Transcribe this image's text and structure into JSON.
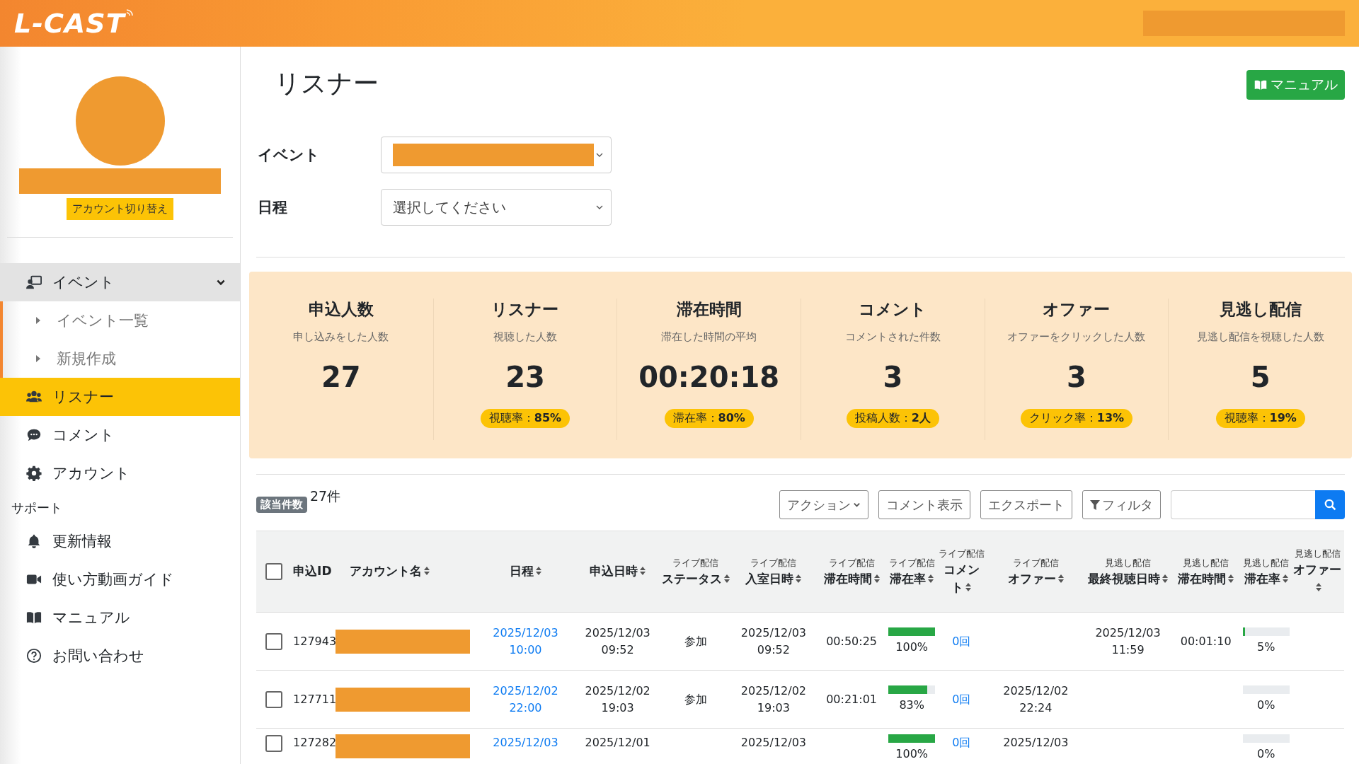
{
  "header": {
    "logo": "L-CAST"
  },
  "sidebar": {
    "account_switch": "アカウント切り替え",
    "nav": [
      {
        "label": "イベント",
        "selected": false,
        "expanded": true,
        "children": [
          {
            "label": "イベント一覧",
            "selected": false
          },
          {
            "label": "新規作成",
            "selected": false
          }
        ]
      },
      {
        "label": "リスナー",
        "selected": true
      },
      {
        "label": "コメント",
        "selected": false
      },
      {
        "label": "アカウント",
        "selected": false
      }
    ],
    "support_heading": "サポート",
    "support": [
      {
        "label": "更新情報"
      },
      {
        "label": "使い方動画ガイド"
      },
      {
        "label": "マニュアル"
      },
      {
        "label": "お問い合わせ"
      }
    ]
  },
  "page": {
    "title": "リスナー",
    "manual_button": "マニュアル",
    "filters": [
      {
        "label": "イベント"
      },
      {
        "label": "日程",
        "value": "選択してください"
      }
    ]
  },
  "stats": [
    {
      "title": "申込人数",
      "subtitle": "申し込みをした人数",
      "value": "27"
    },
    {
      "title": "リスナー",
      "subtitle": "視聴した人数",
      "value": "23",
      "badge": "視聴率：**85%**"
    },
    {
      "title": "滞在時間",
      "subtitle": "滞在した時間の平均",
      "value": "00:20:18",
      "badge": "滞在率：**80%**"
    },
    {
      "title": "コメント",
      "subtitle": "コメントされた件数",
      "value": "3",
      "badge": "投稿人数：**2人**"
    },
    {
      "title": "オファー",
      "subtitle": "オファーをクリックした人数",
      "value": "3",
      "badge": "クリック率：**13%**"
    },
    {
      "title": "見逃し配信",
      "subtitle": "見逃し配信を視聴した人数",
      "value": "5",
      "badge": "視聴率：**19%**"
    }
  ],
  "toolbar": {
    "count_label": "該当件数",
    "count": "27件",
    "buttons": [
      {
        "label": "アクション",
        "kind": "dropdown"
      },
      {
        "label": "コメント表示",
        "kind": "plain"
      },
      {
        "label": "エクスポート",
        "kind": "plain"
      },
      {
        "label": "フィルタ",
        "kind": "filter"
      }
    ]
  },
  "table": {
    "select_all_checked": false,
    "columns": [
      {
        "label": "申込ID",
        "sortable": false
      },
      {
        "label": "アカウント名",
        "sortable": true
      },
      {
        "label": "日程",
        "sortable": true
      },
      {
        "label": "申込日時",
        "sortable": true
      },
      {
        "group": "ライブ配信",
        "label": "ステータス",
        "sortable": true
      },
      {
        "group": "ライブ配信",
        "label": "入室日時",
        "sortable": true
      },
      {
        "group": "ライブ配信",
        "label": "滞在時間",
        "sortable": true
      },
      {
        "group": "ライブ配信",
        "label": "滞在率",
        "sortable": true
      },
      {
        "group": "ライブ配信",
        "label": "コメント",
        "sortable": true
      },
      {
        "group": "ライブ配信",
        "label": "オファー",
        "sortable": true
      },
      {
        "group": "見逃し配信",
        "label": "最終視聴日時",
        "sortable": true
      },
      {
        "group": "見逃し配信",
        "label": "滞在時間",
        "sortable": true
      },
      {
        "group": "見逃し配信",
        "label": "滞在率",
        "sortable": true
      },
      {
        "group": "見逃し配信",
        "label": "オファー",
        "sortable": true
      }
    ],
    "rows": [
      {
        "id": "127943",
        "checked": false,
        "schedule": [
          "2025/12/03",
          "10:00"
        ],
        "applied": [
          "2025/12/03",
          "09:52"
        ],
        "status": "参加",
        "entered": [
          "2025/12/03",
          "09:52"
        ],
        "stay": "00:50:25",
        "stay_rate": {
          "level": 1.0,
          "text": "100%"
        },
        "comments": "0回",
        "offer": [],
        "late_last": [
          "2025/12/03",
          "11:59"
        ],
        "late_stay": "00:01:10",
        "late_rate": {
          "level": 0.05,
          "text": "5%"
        }
      },
      {
        "id": "127711",
        "checked": false,
        "schedule": [
          "2025/12/02",
          "22:00"
        ],
        "applied": [
          "2025/12/02",
          "19:03"
        ],
        "status": "参加",
        "entered": [
          "2025/12/02",
          "19:03"
        ],
        "stay": "00:21:01",
        "stay_rate": {
          "level": 0.83,
          "text": "83%"
        },
        "comments": "0回",
        "offer": [
          "2025/12/02",
          "22:24"
        ],
        "late_last": [],
        "late_stay": "",
        "late_rate": {
          "level": 0,
          "text": "0%"
        }
      },
      {
        "id": "127282",
        "checked": false,
        "schedule": [
          "2025/12/03"
        ],
        "applied": [
          "2025/12/01"
        ],
        "status": "",
        "entered": [
          "2025/12/03"
        ],
        "stay": "",
        "stay_rate": {
          "level": 1.0,
          "text": "100%"
        },
        "comments": "0回",
        "offer": [
          "2025/12/03"
        ],
        "late_last": [],
        "late_stay": "",
        "late_rate": {
          "level": 0,
          "text": "0%"
        }
      }
    ]
  }
}
